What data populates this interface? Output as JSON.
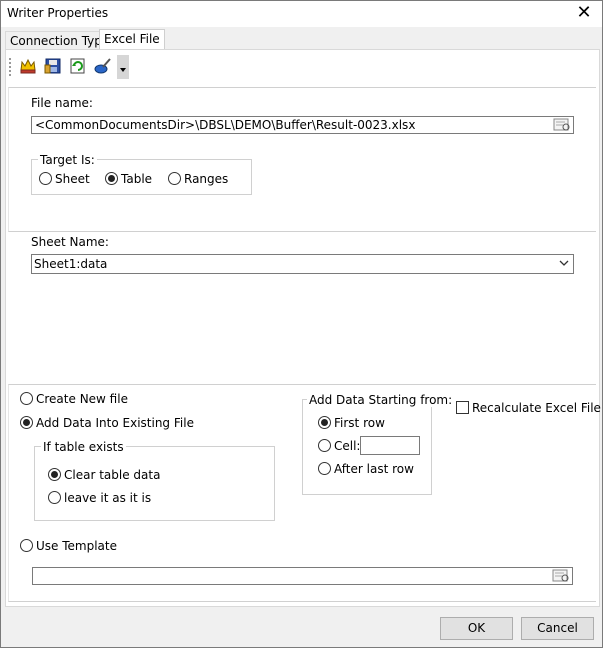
{
  "window": {
    "title": "Writer Properties"
  },
  "tabs": [
    {
      "label": "Connection Type",
      "active": false
    },
    {
      "label": "Excel File",
      "active": true
    }
  ],
  "toolbar": {
    "icons": [
      "crown-icon",
      "save-floppy-icon",
      "refresh-icon",
      "brush-icon"
    ]
  },
  "file": {
    "label": "File name:",
    "value": "<CommonDocumentsDir>\\DBSL\\DEMO\\Buffer\\Result-0023.xlsx"
  },
  "target": {
    "legend": "Target Is:",
    "options": [
      {
        "label": "Sheet",
        "selected": false
      },
      {
        "label": "Table",
        "selected": true
      },
      {
        "label": "Ranges",
        "selected": false
      }
    ]
  },
  "sheet": {
    "label": "Sheet Name:",
    "value": "Sheet1:data"
  },
  "mode": {
    "create_new": "Create New file",
    "add_existing": "Add Data Into Existing File",
    "use_template": "Use Template",
    "selected": "add_existing"
  },
  "table_exists": {
    "legend": "If table exists",
    "options": [
      {
        "label": "Clear table data",
        "selected": true
      },
      {
        "label": "leave it as it is",
        "selected": false
      }
    ]
  },
  "start": {
    "legend": "Add Data Starting from:",
    "options": [
      {
        "label": "First row",
        "selected": true
      },
      {
        "label": "Cell:",
        "selected": false
      },
      {
        "label": "After last row",
        "selected": false
      }
    ],
    "cell_value": ""
  },
  "recalc": {
    "label": "Recalculate Excel File",
    "checked": false
  },
  "template": {
    "value": ""
  },
  "buttons": {
    "ok": "OK",
    "cancel": "Cancel"
  }
}
